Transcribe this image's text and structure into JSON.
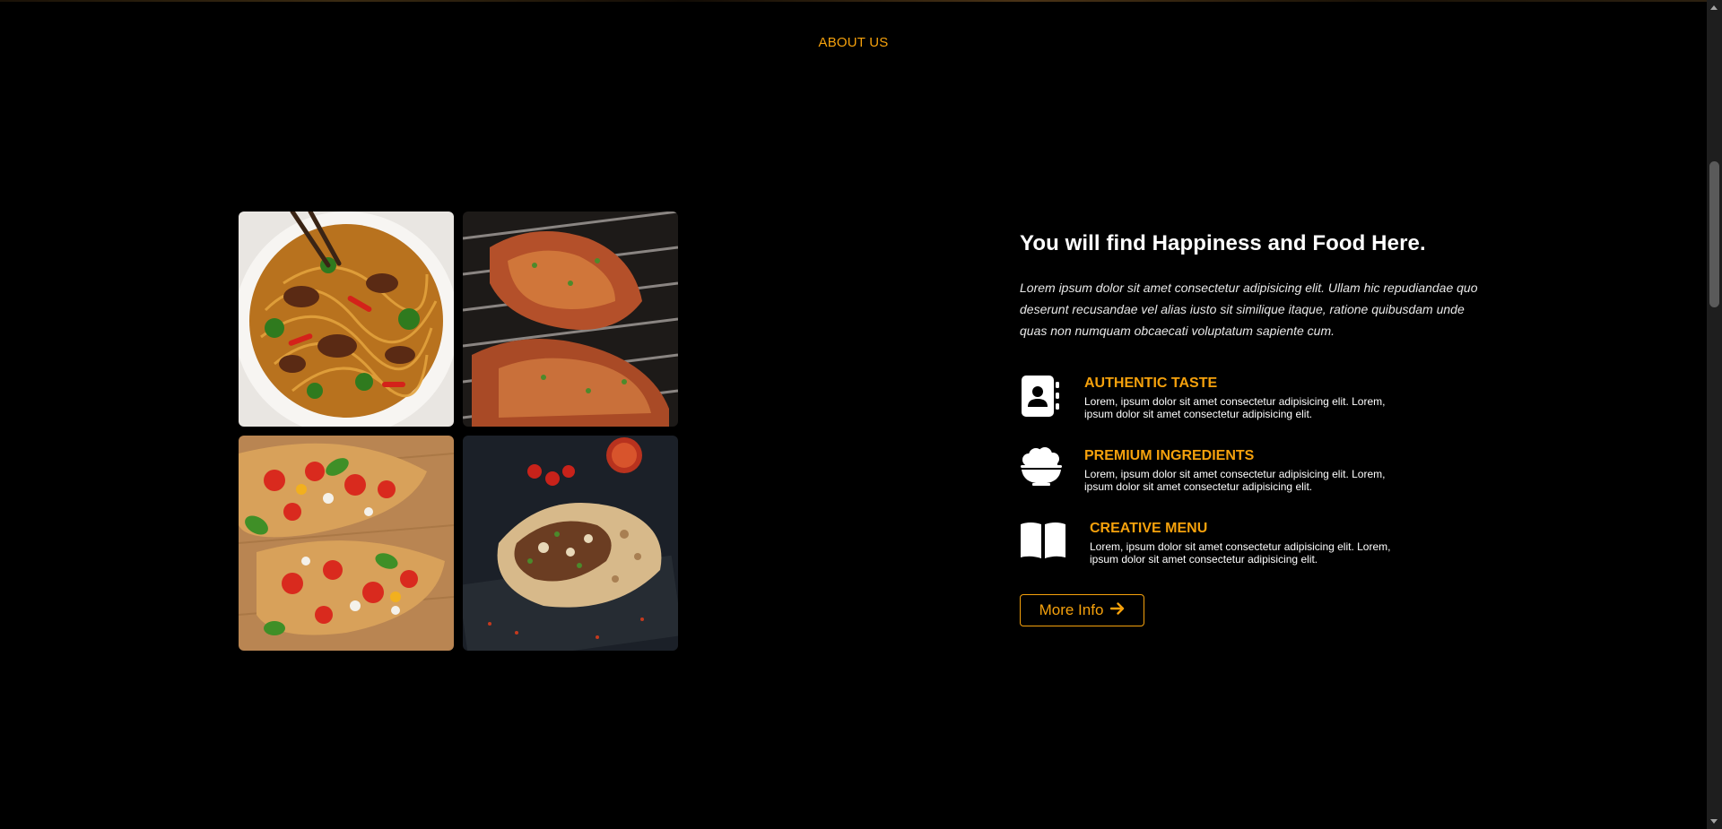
{
  "section": {
    "label": "ABOUT US"
  },
  "gallery": {
    "images": [
      {
        "name": "noodles-with-beef-image"
      },
      {
        "name": "grilled-chicken-image"
      },
      {
        "name": "bruschetta-image"
      },
      {
        "name": "burrito-wrap-image"
      }
    ]
  },
  "about": {
    "headline": "You will find Happiness and Food Here.",
    "intro": "Lorem ipsum dolor sit amet consectetur adipisicing elit. Ullam hic repudiandae quo deserunt recusandae vel alias iusto sit similique itaque, ratione quibusdam unde quas non numquam obcaecati voluptatum sapiente cum.",
    "features": [
      {
        "icon": "contact-book-icon",
        "title": "AUTHENTIC TASTE",
        "description": "Lorem, ipsum dolor sit amet consectetur adipisicing elit. Lorem, ipsum dolor sit amet consectetur adipisicing elit."
      },
      {
        "icon": "rice-bowl-icon",
        "title": "PREMIUM INGREDIENTS",
        "description": "Lorem, ipsum dolor sit amet consectetur adipisicing elit. Lorem, ipsum dolor sit amet consectetur adipisicing elit."
      },
      {
        "icon": "open-book-icon",
        "title": "CREATIVE MENU",
        "description": "Lorem, ipsum dolor sit amet consectetur adipisicing elit. Lorem, ipsum dolor sit amet consectetur adipisicing elit."
      }
    ],
    "button": {
      "label": "More Info",
      "icon": "arrow-right-icon"
    }
  },
  "colors": {
    "accent": "#f5a10c",
    "background": "#000000",
    "text": "#ffffff"
  }
}
